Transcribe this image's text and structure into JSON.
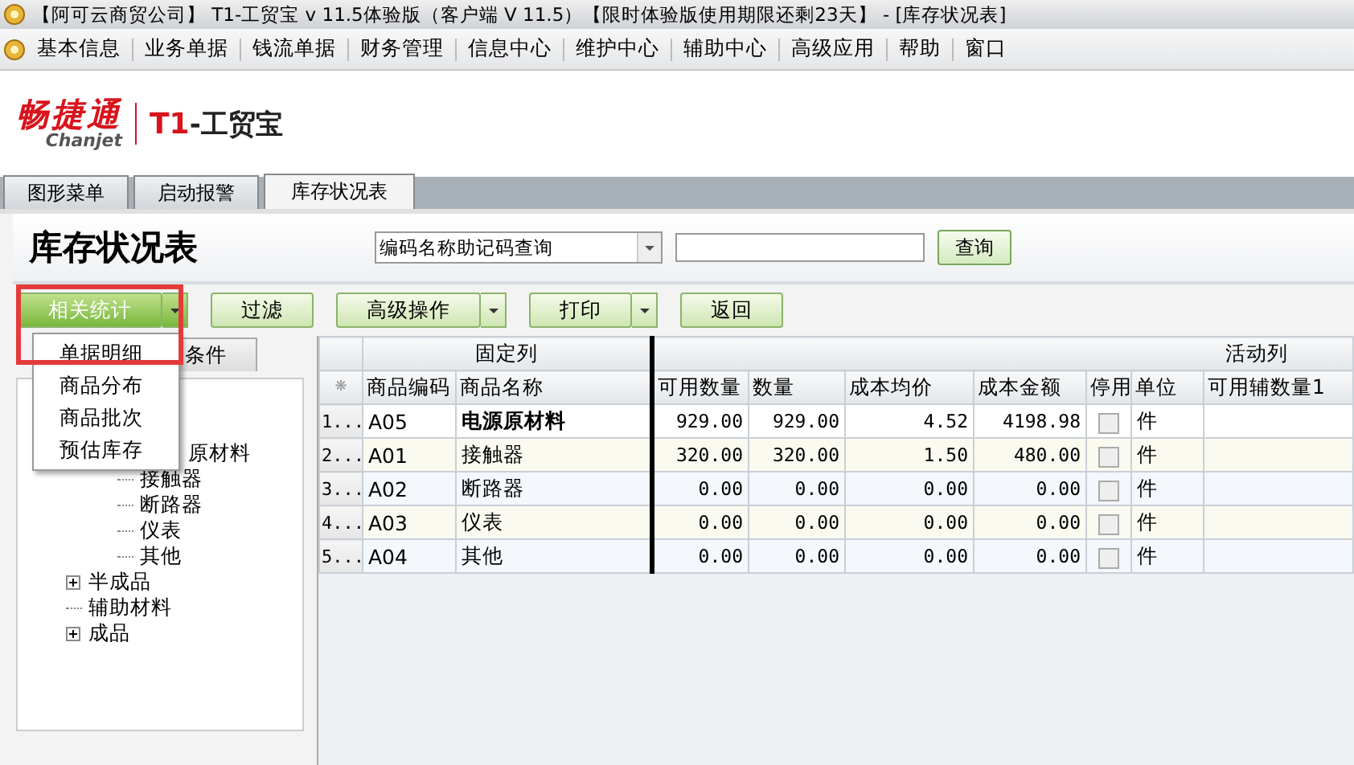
{
  "window": {
    "title": "【阿可云商贸公司】 T1-工贸宝 v 11.5体验版（客户端 V 11.5）【限时体验版使用期限还剩23天】 - [库存状况表]"
  },
  "menu": [
    "基本信息",
    "业务单据",
    "钱流单据",
    "财务管理",
    "信息中心",
    "维护中心",
    "辅助中心",
    "高级应用",
    "帮助",
    "窗口"
  ],
  "logo": {
    "brand": "畅捷通",
    "brand_latin": "Chanjet",
    "product_mark": "T1",
    "product": "-工贸宝"
  },
  "tabs": [
    {
      "label": "图形菜单",
      "selected": false
    },
    {
      "label": "启动报警",
      "selected": false
    },
    {
      "label": "库存状况表",
      "selected": true
    }
  ],
  "page_title": "库存状况表",
  "search": {
    "mode": "编码名称助记码查询",
    "button": "查询"
  },
  "toolbar": [
    {
      "label": "相关统计",
      "kind": "split",
      "open": true
    },
    {
      "label": "过滤",
      "kind": "plain",
      "open": false
    },
    {
      "label": "高级操作",
      "kind": "split",
      "open": false
    },
    {
      "label": "打印",
      "kind": "split",
      "open": false
    },
    {
      "label": "返回",
      "kind": "plain",
      "open": false
    }
  ],
  "dropdown_menu": [
    "单据明细",
    "商品分布",
    "商品批次",
    "预估库存"
  ],
  "highlight_frame": true,
  "left_tab": "条件",
  "tree": [
    {
      "label": "原材料",
      "children": [
        {
          "label": "接触器"
        },
        {
          "label": "断路器"
        },
        {
          "label": "仪表"
        },
        {
          "label": "其他"
        }
      ]
    },
    {
      "label": "半成品",
      "expanded": false
    },
    {
      "label": "辅助材料"
    },
    {
      "label": "成品",
      "expanded": false
    }
  ],
  "table": {
    "groups": [
      "固定列",
      "活动列"
    ],
    "star": "❋",
    "columns": [
      "商品编码",
      "商品名称",
      "可用数量",
      "数量",
      "成本均价",
      "成本金额",
      "停用",
      "单位",
      "可用辅数量1"
    ],
    "rows": [
      {
        "index": "1...",
        "selected": true,
        "cells": [
          "A05",
          "电源原材料",
          "929.00",
          "929.00",
          "4.52",
          "4198.98"
        ],
        "disabled_flag": false,
        "unit": "件"
      },
      {
        "index": "2...",
        "selected": false,
        "cells": [
          "A01",
          "接触器",
          "320.00",
          "320.00",
          "1.50",
          "480.00"
        ],
        "disabled_flag": false,
        "unit": "件"
      },
      {
        "index": "3...",
        "selected": false,
        "cells": [
          "A02",
          "断路器",
          "0.00",
          "0.00",
          "0.00",
          "0.00"
        ],
        "disabled_flag": false,
        "unit": "件"
      },
      {
        "index": "4...",
        "selected": false,
        "cells": [
          "A03",
          "仪表",
          "0.00",
          "0.00",
          "0.00",
          "0.00"
        ],
        "disabled_flag": false,
        "unit": "件"
      },
      {
        "index": "5...",
        "selected": false,
        "cells": [
          "A04",
          "其他",
          "0.00",
          "0.00",
          "0.00",
          "0.00"
        ],
        "disabled_flag": false,
        "unit": "件"
      }
    ]
  }
}
